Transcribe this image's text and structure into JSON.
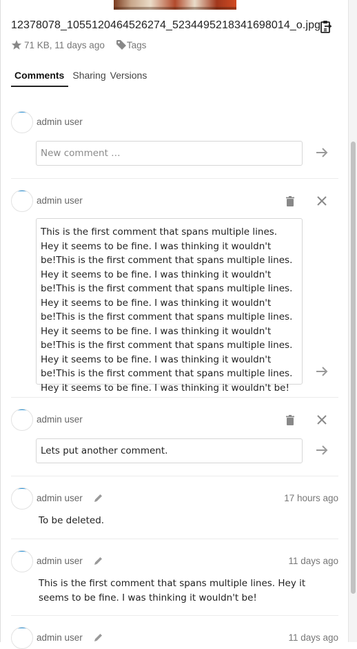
{
  "file": {
    "name": "12378078_1055120464526274_5234495218341698014_o.jpg",
    "meta": "71 KB, 11 days ago",
    "tags_label": "Tags"
  },
  "tabs": [
    "Comments",
    "Sharing",
    "Versions"
  ],
  "new_comment": {
    "author": "admin user",
    "placeholder": "New comment …"
  },
  "editing": [
    {
      "author": "admin user",
      "text": "This is the first comment that spans multiple lines. Hey it seems to be fine. I was thinking it wouldn't be!This is the first comment that spans multiple lines. Hey it seems to be fine. I was thinking it wouldn't be!This is the first comment that spans multiple lines. Hey it seems to be fine. I was thinking it wouldn't be!This is the first comment that spans multiple lines. Hey it seems to be fine. I was thinking it wouldn't be!This is the first comment that spans multiple lines. Hey it seems to be fine. I was thinking it wouldn't be!This is the first comment that spans multiple lines. Hey it seems to be fine. I was thinking it wouldn't be!"
    },
    {
      "author": "admin user",
      "text": "Lets put another comment."
    }
  ],
  "comments": [
    {
      "author": "admin user",
      "time": "17 hours ago",
      "text": "To be deleted."
    },
    {
      "author": "admin user",
      "time": "11 days ago",
      "text": "This is the first comment that spans multiple lines. Hey it seems to be fine. I was thinking it wouldn't be!"
    },
    {
      "author": "admin user",
      "time": "11 days ago",
      "text": ""
    }
  ],
  "colors": {
    "accent": "#1f8bd3",
    "icon_gray": "#888888"
  },
  "icons": [
    "clipboard-icon",
    "star-icon",
    "tag-icon",
    "trash-icon",
    "close-icon",
    "send-arrow-icon",
    "pencil-icon"
  ]
}
